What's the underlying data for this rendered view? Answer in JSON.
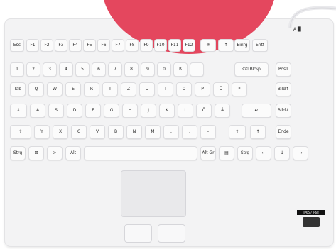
{
  "leds": "A █",
  "rows": [
    [
      "Esc",
      "F1",
      "F2",
      "F3",
      "F4",
      "F5",
      "F6",
      "F7",
      "F8",
      "F9",
      "F10",
      "F11",
      "F12",
      "✵",
      "↑",
      "Einfg",
      "Entf"
    ],
    [
      "1",
      "2",
      "3",
      "4",
      "5",
      "6",
      "7",
      "8",
      "9",
      "0",
      "ß",
      "´",
      "⌫ BkSp",
      "Pos1"
    ],
    [
      "Tab",
      "Q",
      "W",
      "E",
      "R",
      "T",
      "Z",
      "U",
      "I",
      "O",
      "P",
      "Ü",
      "*",
      "Bild↑"
    ],
    [
      "⇩",
      "A",
      "S",
      "D",
      "F",
      "G",
      "H",
      "J",
      "K",
      "L",
      "Ö",
      "Ä",
      "↵",
      "Bild↓"
    ],
    [
      "⇧",
      "Y",
      "X",
      "C",
      "V",
      "B",
      "N",
      "M",
      ",",
      ".",
      "-",
      "⇧",
      "↑",
      "Ende"
    ],
    [
      "Strg",
      "⊞",
      ">",
      "Alt",
      "",
      "Alt Gr",
      "▤",
      "Strg",
      "←",
      "↓",
      "→"
    ]
  ],
  "label": "IP65 / IP68"
}
